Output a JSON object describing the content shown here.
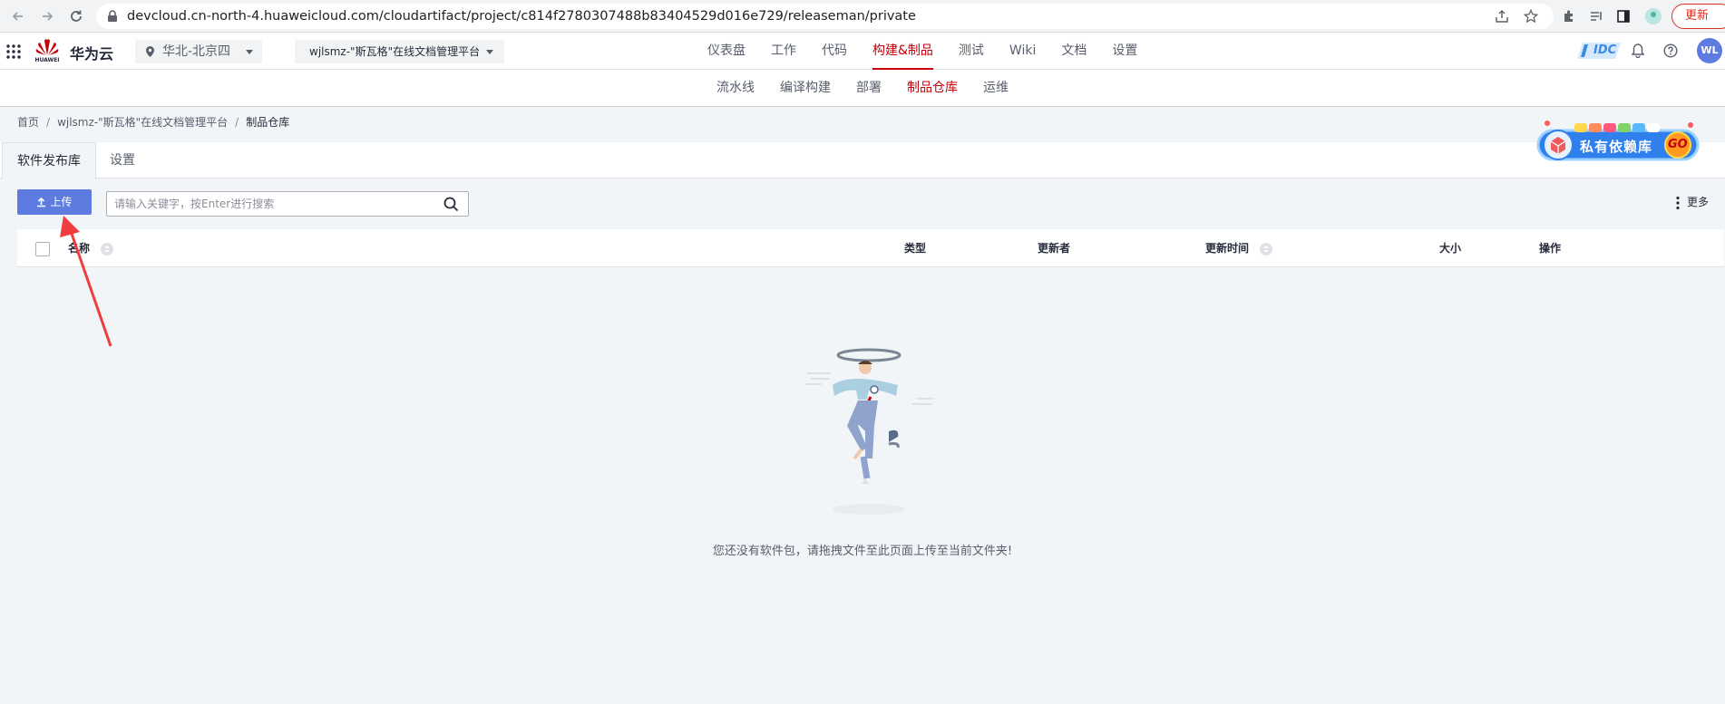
{
  "browser": {
    "url": "devcloud.cn-north-4.huaweicloud.com/cloudartifact/project/c814f2780307488b83404529d016e729/releaseman/private",
    "update_label": "更新"
  },
  "header": {
    "brand_sub": "HUAWEI",
    "brand_name": "华为云",
    "region": "华北-北京四",
    "project": "wjlsmz-\"斯瓦格\"在线文档管理平台",
    "nav": [
      {
        "label": "仪表盘"
      },
      {
        "label": "工作"
      },
      {
        "label": "代码"
      },
      {
        "label": "构建&制品"
      },
      {
        "label": "测试"
      },
      {
        "label": "Wiki"
      },
      {
        "label": "文档"
      },
      {
        "label": "设置"
      }
    ],
    "active_nav": "构建&制品",
    "idc_label": "IDC",
    "avatar": "WL"
  },
  "subnav": {
    "items": [
      {
        "label": "流水线"
      },
      {
        "label": "编译构建"
      },
      {
        "label": "部署"
      },
      {
        "label": "制品仓库"
      },
      {
        "label": "运维"
      }
    ],
    "active": "制品仓库"
  },
  "breadcrumb": {
    "home": "首页",
    "project": "wjlsmz-\"斯瓦格\"在线文档管理平台",
    "current": "制品仓库"
  },
  "tabs": {
    "release": "软件发布库",
    "settings": "设置"
  },
  "promo": {
    "text": "私有依赖库",
    "go": "GO"
  },
  "toolbar": {
    "upload_label": "上传",
    "search_placeholder": "请输入关键字，按Enter进行搜索",
    "more_label": "更多"
  },
  "table": {
    "columns": {
      "name": "名称",
      "type": "类型",
      "updater": "更新者",
      "update_time": "更新时间",
      "size": "大小",
      "actions": "操作"
    }
  },
  "empty": {
    "message": "您还没有软件包，请拖拽文件至此页面上传至当前文件夹!"
  },
  "colors": {
    "brand_red": "#c7000b",
    "primary": "#5e7ce0",
    "annotation_arrow": "#f03e3e"
  }
}
